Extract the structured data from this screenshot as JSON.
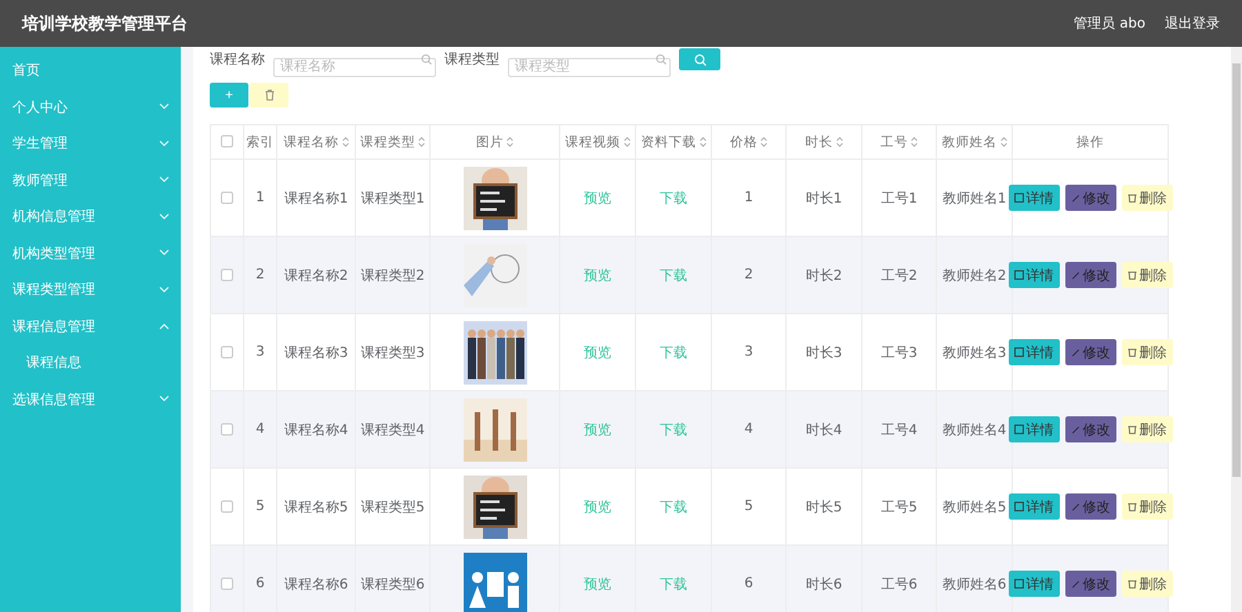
{
  "header": {
    "title": "培训学校教学管理平台",
    "user": "管理员 abo",
    "logout": "退出登录"
  },
  "sidebar": {
    "items": [
      {
        "label": "首页",
        "kind": "link"
      },
      {
        "label": "个人中心",
        "kind": "menu",
        "expanded": false
      },
      {
        "label": "学生管理",
        "kind": "menu",
        "expanded": false
      },
      {
        "label": "教师管理",
        "kind": "menu",
        "expanded": false
      },
      {
        "label": "机构信息管理",
        "kind": "menu",
        "expanded": false
      },
      {
        "label": "机构类型管理",
        "kind": "menu",
        "expanded": false
      },
      {
        "label": "课程类型管理",
        "kind": "menu",
        "expanded": false
      },
      {
        "label": "课程信息管理",
        "kind": "menu",
        "expanded": true,
        "children": [
          {
            "label": "课程信息"
          }
        ]
      },
      {
        "label": "选课信息管理",
        "kind": "menu",
        "expanded": false
      }
    ]
  },
  "search": {
    "fields": [
      {
        "label": "课程名称",
        "placeholder": "课程名称"
      },
      {
        "label": "课程类型",
        "placeholder": "课程类型"
      }
    ]
  },
  "toolbar": {
    "add_label": "+"
  },
  "table": {
    "all_checked": false,
    "columns": [
      {
        "label": "索引",
        "sortable": false
      },
      {
        "label": "课程名称",
        "sortable": true
      },
      {
        "label": "课程类型",
        "sortable": true
      },
      {
        "label": "图片",
        "sortable": true
      },
      {
        "label": "课程视频",
        "sortable": true
      },
      {
        "label": "资料下载",
        "sortable": true
      },
      {
        "label": "价格",
        "sortable": true
      },
      {
        "label": "时长",
        "sortable": true
      },
      {
        "label": "工号",
        "sortable": true
      },
      {
        "label": "教师姓名",
        "sortable": true
      },
      {
        "label": "操作",
        "sortable": false
      }
    ],
    "rows": [
      {
        "checked": false,
        "index": "1",
        "name": "课程名称1",
        "type": "课程类型1",
        "video": "预览",
        "download": "下载",
        "price": "1",
        "duration": "时长1",
        "job_no": "工号1",
        "teacher": "教师姓名1",
        "actions": [
          {
            "kind": "detail",
            "label": "详情"
          },
          {
            "kind": "edit",
            "label": "修改"
          },
          {
            "kind": "delete",
            "label": "删除"
          }
        ]
      },
      {
        "checked": false,
        "index": "2",
        "name": "课程名称2",
        "type": "课程类型2",
        "video": "预览",
        "download": "下载",
        "price": "2",
        "duration": "时长2",
        "job_no": "工号2",
        "teacher": "教师姓名2",
        "actions": [
          {
            "kind": "detail",
            "label": "详情"
          },
          {
            "kind": "edit",
            "label": "修改"
          },
          {
            "kind": "delete",
            "label": "删除"
          }
        ]
      },
      {
        "checked": false,
        "index": "3",
        "name": "课程名称3",
        "type": "课程类型3",
        "video": "预览",
        "download": "下载",
        "price": "3",
        "duration": "时长3",
        "job_no": "工号3",
        "teacher": "教师姓名3",
        "actions": [
          {
            "kind": "detail",
            "label": "详情"
          },
          {
            "kind": "edit",
            "label": "修改"
          },
          {
            "kind": "delete",
            "label": "删除"
          }
        ]
      },
      {
        "checked": false,
        "index": "4",
        "name": "课程名称4",
        "type": "课程类型4",
        "video": "预览",
        "download": "下载",
        "price": "4",
        "duration": "时长4",
        "job_no": "工号4",
        "teacher": "教师姓名4",
        "actions": [
          {
            "kind": "detail",
            "label": "详情"
          },
          {
            "kind": "edit",
            "label": "修改"
          },
          {
            "kind": "delete",
            "label": "删除"
          }
        ]
      },
      {
        "checked": false,
        "index": "5",
        "name": "课程名称5",
        "type": "课程类型5",
        "video": "预览",
        "download": "下载",
        "price": "5",
        "duration": "时长5",
        "job_no": "工号5",
        "teacher": "教师姓名5",
        "actions": [
          {
            "kind": "detail",
            "label": "详情"
          },
          {
            "kind": "edit",
            "label": "修改"
          },
          {
            "kind": "delete",
            "label": "删除"
          }
        ]
      },
      {
        "checked": false,
        "index": "6",
        "name": "课程名称6",
        "type": "课程类型6",
        "video": "预览",
        "download": "下载",
        "price": "6",
        "duration": "时长6",
        "job_no": "工号6",
        "teacher": "教师姓名6",
        "actions": [
          {
            "kind": "detail",
            "label": "详情"
          },
          {
            "kind": "edit",
            "label": "修改"
          },
          {
            "kind": "delete",
            "label": "删除"
          }
        ]
      }
    ]
  }
}
